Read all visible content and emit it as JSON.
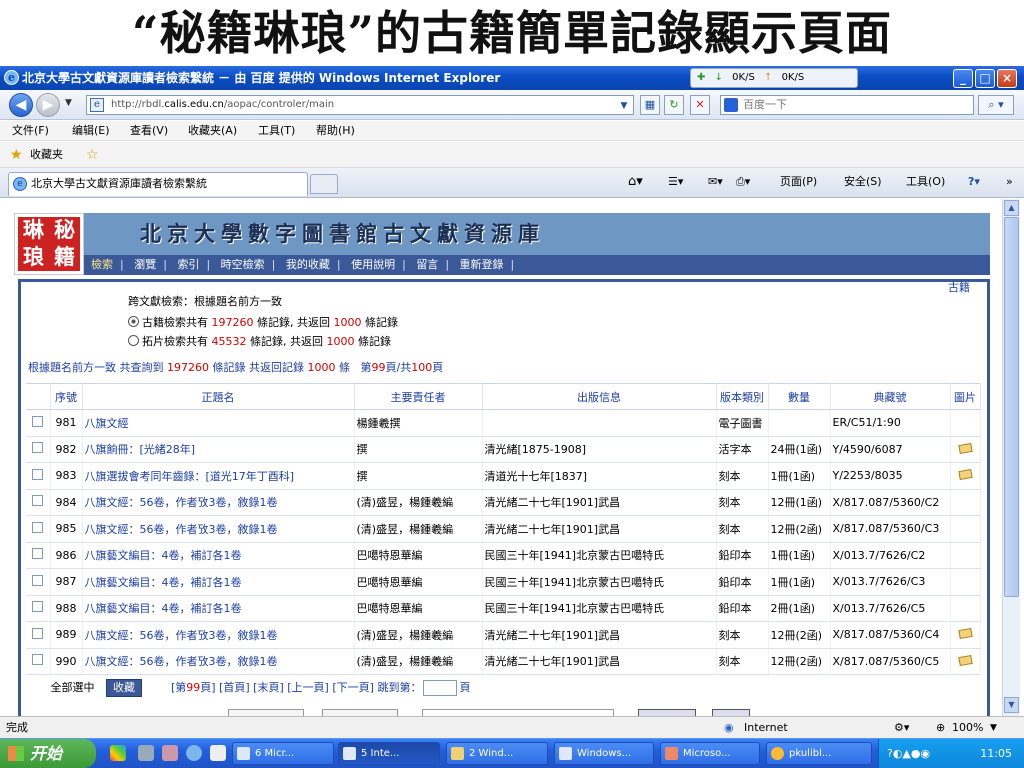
{
  "slide_title": "“秘籍琳琅”的古籍簡單記錄顯示頁面",
  "window": {
    "title": "北京大學古文獻資源庫讀者檢索繫統 － 由 百度 提供的 Windows Internet Explorer",
    "toast": {
      "down": "0K/S",
      "up": "0K/S"
    },
    "min": "_",
    "max": "□",
    "close": "×"
  },
  "address": {
    "url_prefix": "http://rbdl.",
    "url_host": "calis.edu.cn",
    "url_path": "/aopac/controler/main",
    "search_placeholder": "百度一下"
  },
  "menu": [
    "文件(F)",
    "编辑(E)",
    "查看(V)",
    "收藏夹(A)",
    "工具(T)",
    "帮助(H)"
  ],
  "favorites_label": "收藏夹",
  "tab_title": "北京大學古文獻資源庫讀者檢索繫統",
  "commands": {
    "page": "页面(P)",
    "safety": "安全(S)",
    "tools": "工具(O)"
  },
  "site": {
    "logo_chars": [
      "琳",
      "秘",
      "琅",
      "籍"
    ],
    "title": "北京大學數字圖書館古文獻資源庫",
    "nav": [
      "檢索",
      "瀏覽",
      "索引",
      "時空檢索",
      "我的收藏",
      "使用說明",
      "留言",
      "重新登錄"
    ],
    "nav_active": 0,
    "guji_label": "古籍"
  },
  "search_info": {
    "line1": "跨文獻檢索：根據題名前方一致",
    "ancient": {
      "prefix": "古籍檢索共有",
      "count": "197260",
      "mid": "條記錄, 共返回",
      "returned": "1000",
      "suffix": "條記錄"
    },
    "rubbing": {
      "prefix": "拓片檢索共有",
      "count": "45532",
      "mid": "條記錄, 共返回",
      "returned": "1000",
      "suffix": "條記錄"
    },
    "summary": {
      "prefix": "根據題名前方一致",
      "found_label": "共查詢到",
      "found": "197260",
      "found_suffix": "條記錄",
      "ret_label": "共返回記錄",
      "returned": "1000",
      "ret_suffix": "條",
      "page_label": "第",
      "page": "99",
      "page_mid": "頁/共",
      "total": "100",
      "page_suffix": "頁"
    }
  },
  "table": {
    "headers": [
      "序號",
      "正題名",
      "主要責任者",
      "出版信息",
      "版本類別",
      "數量",
      "典藏號",
      "圖片"
    ],
    "rows": [
      {
        "no": "981",
        "title": "八旗文經",
        "author": "楊鍾羲撰",
        "pub": "",
        "type": "電子圖書",
        "qty": "",
        "call": "ER/C51/1:90",
        "pic": false
      },
      {
        "no": "982",
        "title": "八旗餉冊：[光緒28年]",
        "author": "撰",
        "pub": "清光緒[1875-1908]",
        "type": "活字本",
        "qty": "24冊(1函)",
        "call": "Y/4590/6087",
        "pic": true
      },
      {
        "no": "983",
        "title": "八旗選拔會考同年齒錄：[道光17年丁酉科]",
        "author": "撰",
        "pub": "清道光十七年[1837]",
        "type": "刻本",
        "qty": "1冊(1函)",
        "call": "Y/2253/8035",
        "pic": true
      },
      {
        "no": "984",
        "title": "八旗文經：56卷，作者攷3卷，敘錄1卷",
        "author": "(清)盛昱，楊鍾羲編",
        "pub": "清光緒二十七年[1901]武昌",
        "type": "刻本",
        "qty": "12冊(1函)",
        "call": "X/817.087/5360/C2",
        "pic": false
      },
      {
        "no": "985",
        "title": "八旗文經：56卷，作者攷3卷，敘錄1卷",
        "author": "(清)盛昱，楊鍾羲編",
        "pub": "清光緒二十七年[1901]武昌",
        "type": "刻本",
        "qty": "12冊(2函)",
        "call": "X/817.087/5360/C3",
        "pic": false
      },
      {
        "no": "986",
        "title": "八旗藝文編目：4卷，補訂各1卷",
        "author": "巴噶特恩華編",
        "pub": "民國三十年[1941]北京蒙古巴噶特氏",
        "type": "鉛印本",
        "qty": "1冊(1函)",
        "call": "X/013.7/7626/C2",
        "pic": false
      },
      {
        "no": "987",
        "title": "八旗藝文編目：4卷，補訂各1卷",
        "author": "巴噶特恩華編",
        "pub": "民國三十年[1941]北京蒙古巴噶特氏",
        "type": "鉛印本",
        "qty": "1冊(1函)",
        "call": "X/013.7/7626/C3",
        "pic": false
      },
      {
        "no": "988",
        "title": "八旗藝文編目：4卷，補訂各1卷",
        "author": "巴噶特恩華編",
        "pub": "民國三十年[1941]北京蒙古巴噶特氏",
        "type": "鉛印本",
        "qty": "2冊(1函)",
        "call": "X/013.7/7626/C5",
        "pic": false
      },
      {
        "no": "989",
        "title": "八旗文經：56卷，作者攷3卷，敘錄1卷",
        "author": "(清)盛昱，楊鍾羲編",
        "pub": "清光緒二十七年[1901]武昌",
        "type": "刻本",
        "qty": "12冊(2函)",
        "call": "X/817.087/5360/C4",
        "pic": true
      },
      {
        "no": "990",
        "title": "八旗文經：56卷，作者攷3卷，敘錄1卷",
        "author": "(清)盛昱，楊鍾羲編",
        "pub": "清光緒二十七年[1901]武昌",
        "type": "刻本",
        "qty": "12冊(2函)",
        "call": "X/817.087/5360/C5",
        "pic": true
      }
    ]
  },
  "pager": {
    "select_all": "全部選中",
    "fav_button": "收藏",
    "current_open": "[第",
    "current": "99",
    "current_close": "頁]",
    "first": "[首頁]",
    "last": "[末頁]",
    "prev": "[上一頁]",
    "next": "[下一頁]",
    "jump_label": "跳到第：",
    "jump_suffix": "頁"
  },
  "status": {
    "text": "完成",
    "zone": "Internet",
    "zoom": "100%"
  },
  "taskbar": {
    "start": "开始",
    "tasks": [
      "6 Micr...",
      "5 Inte...",
      "2 Wind...",
      "Windows...",
      "Microso...",
      "pkulibl..."
    ],
    "active_task": 1,
    "clock": "11:05"
  },
  "colors": {
    "accent": "#3b5998",
    "header_band": "#6f97c4",
    "highlight_red": "#d40000",
    "link_blue": "#1d3fa5"
  }
}
